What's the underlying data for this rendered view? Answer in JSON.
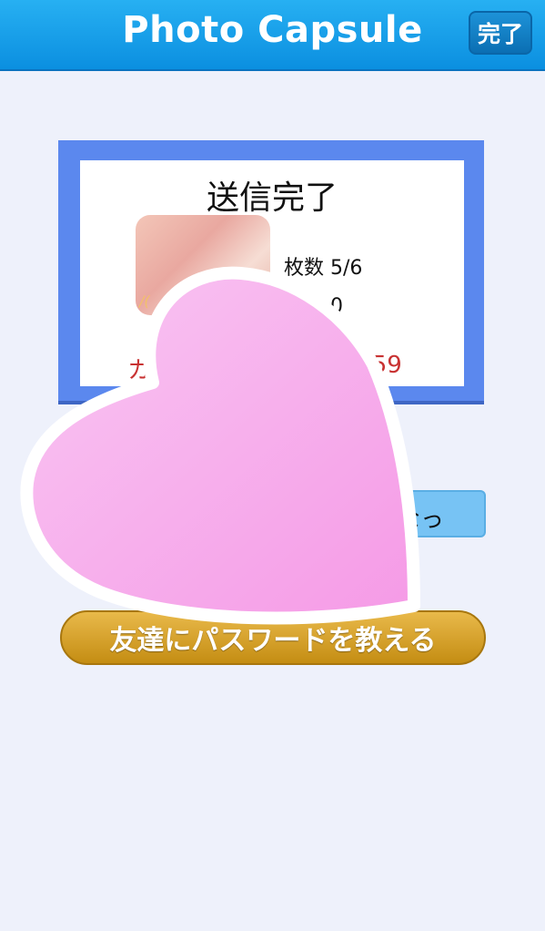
{
  "navbar": {
    "title": "Photo Capsule",
    "done_label": "完了"
  },
  "card": {
    "title": "送信完了",
    "count_text": "枚数 5/6",
    "viewers_text": "者数 0",
    "countdown_left": "カ",
    "countdown_right": ":59",
    "thumb_mark": "/("
  },
  "blue_button": {
    "label": "なっ"
  },
  "gold_button": {
    "label": "友達にパスワードを教える"
  },
  "overlay": {
    "heart_color": "#f6a8ea",
    "outline_color": "#ffffff"
  },
  "colors": {
    "navbar": "#1aa0ea",
    "card_border": "#5b88ee",
    "accent_red": "#c83232",
    "gold": "#d9a52f"
  }
}
